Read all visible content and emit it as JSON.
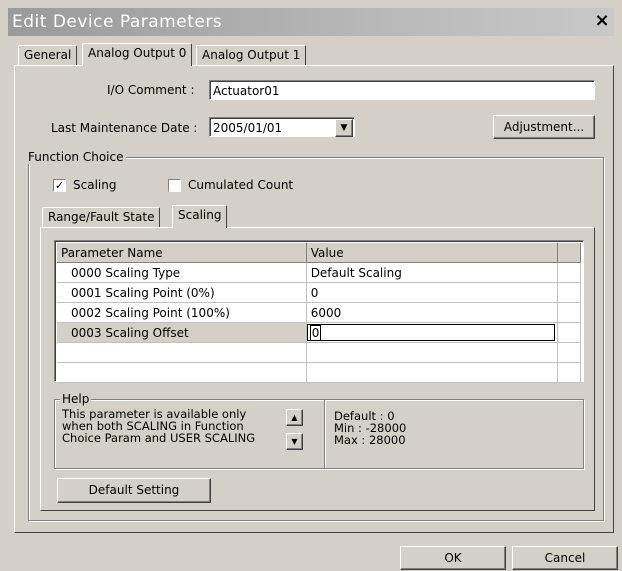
{
  "window": {
    "title": "Edit Device Parameters",
    "close_label": "×"
  },
  "tabs": [
    {
      "label": "General"
    },
    {
      "label": "Analog Output 0"
    },
    {
      "label": "Analog Output 1"
    }
  ],
  "io_comment": {
    "label": "I/O Comment :",
    "value": "Actuator01"
  },
  "maintenance": {
    "label": "Last Maintenance Date :",
    "value": "2005/01/01",
    "dropdown_icon": "▼"
  },
  "adjustment_button": "Adjustment...",
  "function_choice": {
    "title": "Function Choice",
    "scaling": {
      "label": "Scaling",
      "checked": true,
      "mark": "✓"
    },
    "cumulated": {
      "label": "Cumulated Count",
      "checked": false
    }
  },
  "subtabs": [
    {
      "label": "Range/Fault State"
    },
    {
      "label": "Scaling"
    }
  ],
  "grid": {
    "headers": [
      "Parameter Name",
      "Value"
    ],
    "rows": [
      {
        "name": "0000 Scaling Type",
        "value": "Default Scaling"
      },
      {
        "name": "0001 Scaling Point (0%)",
        "value": "0"
      },
      {
        "name": "0002 Scaling Point (100%)",
        "value": "6000"
      },
      {
        "name": "0003 Scaling Offset",
        "value": "0"
      }
    ]
  },
  "help": {
    "title": "Help",
    "text_lines": [
      "This parameter is available only",
      "when both SCALING in Function",
      "Choice Param and USER SCALING"
    ],
    "up_icon": "▲",
    "down_icon": "▼",
    "info_lines": [
      "Default : 0",
      "Min : -28000",
      "Max : 28000"
    ]
  },
  "default_setting_button": "Default Setting",
  "footer": {
    "ok": "OK",
    "cancel": "Cancel"
  }
}
